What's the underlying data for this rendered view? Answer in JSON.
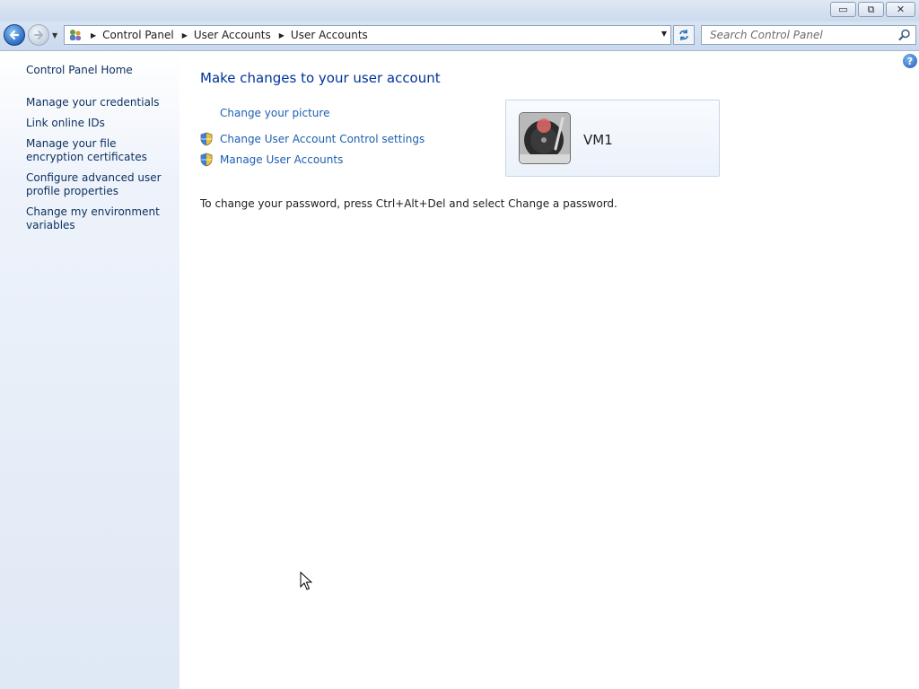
{
  "window": {
    "minimize_glyph": "▭",
    "maximize_glyph": "⧉",
    "close_glyph": "✕"
  },
  "navbar": {
    "breadcrumbs": [
      "Control Panel",
      "User Accounts",
      "User Accounts"
    ],
    "search_placeholder": "Search Control Panel"
  },
  "sidebar": {
    "items": [
      {
        "label": "Control Panel Home"
      },
      {
        "label": "Manage your credentials"
      },
      {
        "label": "Link online IDs"
      },
      {
        "label": "Manage your file encryption certificates"
      },
      {
        "label": "Configure advanced user profile properties"
      },
      {
        "label": "Change my environment variables"
      }
    ]
  },
  "main": {
    "heading": "Make changes to your user account",
    "tasks": [
      {
        "label": "Change your picture",
        "icon": "none"
      },
      {
        "label": "Change User Account Control settings",
        "icon": "uac-shield-icon"
      },
      {
        "label": "Manage User Accounts",
        "icon": "uac-shield-icon"
      }
    ],
    "user": {
      "name": "VM1"
    },
    "password_note": "To change your password, press Ctrl+Alt+Del and select Change a password."
  },
  "colors": {
    "link": "#1c5fb0",
    "heading": "#003399",
    "sidebar_link": "#0b2f5e"
  }
}
